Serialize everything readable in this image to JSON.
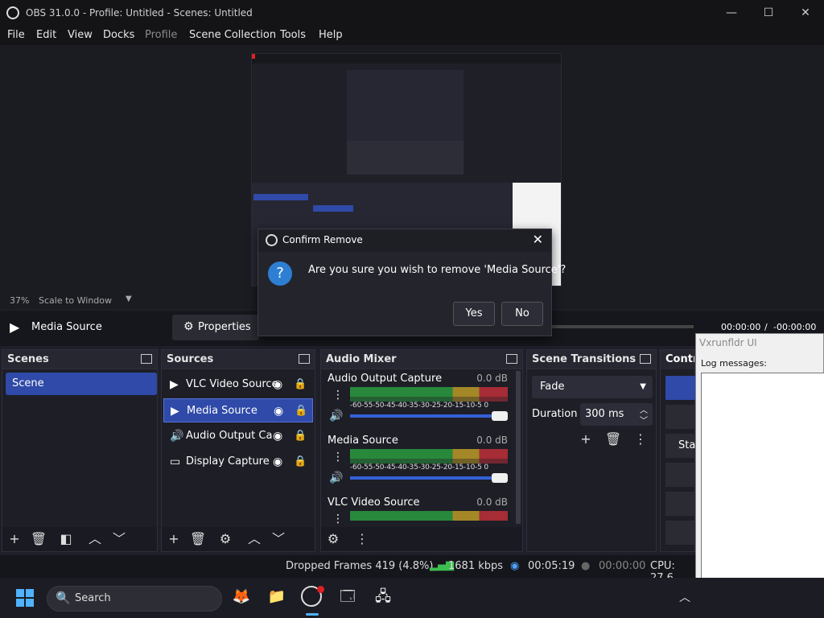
{
  "window": {
    "title": "OBS 31.0.0 - Profile: Untitled - Scenes: Untitled"
  },
  "menu": [
    "File",
    "Edit",
    "View",
    "Docks",
    "Profile",
    "Scene Collection",
    "Tools",
    "Help"
  ],
  "preview": {
    "zoom": "37%",
    "scale_mode": "Scale to Window"
  },
  "media_controls": {
    "source_name": "Media Source",
    "properties_label": "Properties",
    "time_current": "00:00:00",
    "time_separator": "/",
    "time_remaining": "-00:00:00"
  },
  "dialog": {
    "title": "Confirm Remove",
    "message": "Are you sure you wish to remove 'Media Source'?",
    "yes": "Yes",
    "no": "No"
  },
  "scenes": {
    "title": "Scenes",
    "items": [
      "Scene"
    ]
  },
  "sources": {
    "title": "Sources",
    "items": [
      {
        "name": "VLC Video Source",
        "icon": "play-icon"
      },
      {
        "name": "Media Source",
        "icon": "play-icon"
      },
      {
        "name": "Audio Output Capture",
        "icon": "speaker-icon"
      },
      {
        "name": "Display Capture",
        "icon": "monitor-icon"
      }
    ]
  },
  "audio_mixer": {
    "title": "Audio Mixer",
    "channels": [
      {
        "name": "Audio Output Capture",
        "db": "0.0 dB"
      },
      {
        "name": "Media Source",
        "db": "0.0 dB"
      },
      {
        "name": "VLC Video Source",
        "db": "0.0 dB"
      }
    ],
    "ticks": "-60-55-50-45-40-35-30-25-20-15-10-5 0"
  },
  "scene_transitions": {
    "title": "Scene Transitions",
    "transition": "Fade",
    "duration_label": "Duration",
    "duration_value": "300 ms"
  },
  "controls": {
    "title": "Controls",
    "start_partial": "Sta"
  },
  "status": {
    "dropped_frames": "Dropped Frames 419 (4.8%)",
    "bitrate": "1681 kbps",
    "stream_time": "00:05:19",
    "record_time": "00:00:00",
    "cpu": "CPU: 27.6"
  },
  "taskbar": {
    "search": "Search"
  },
  "right_window": {
    "title": "Vxrunfldr UI",
    "label": "Log messages:"
  },
  "colors": {
    "accent": "#2f4aa8",
    "bg": "#1e1f29"
  }
}
